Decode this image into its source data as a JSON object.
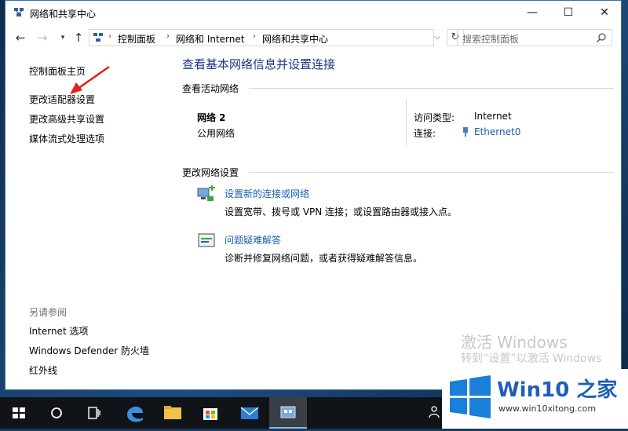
{
  "window": {
    "title": "网络和共享中心",
    "min_glyph": "—",
    "max_glyph": "☐",
    "close_glyph": "✕"
  },
  "nav": {
    "breadcrumb": [
      "控制面板",
      "网络和 Internet",
      "网络和共享中心"
    ],
    "search_placeholder": "搜索控制面板"
  },
  "sidebar": {
    "items": [
      "控制面板主页",
      "更改适配器设置",
      "更改高级共享设置",
      "媒体流式处理选项"
    ],
    "see_also_label": "另请参阅",
    "see_also": [
      "Internet 选项",
      "Windows Defender 防火墙",
      "红外线"
    ]
  },
  "main": {
    "title": "查看基本网络信息并设置连接",
    "active_networks_label": "查看活动网络",
    "network": {
      "name": "网络 2",
      "type": "公用网络",
      "access_type_label": "访问类型:",
      "access_type_value": "Internet",
      "connection_label": "连接:",
      "connection_value": "Ethernet0"
    },
    "change_settings_label": "更改网络设置",
    "tasks": [
      {
        "link": "设置新的连接或网络",
        "desc": "设置宽带、拨号或 VPN 连接；或设置路由器或接入点。"
      },
      {
        "link": "问题疑难解答",
        "desc": "诊断并修复网络问题，或者获得疑难解答信息。"
      }
    ]
  },
  "watermark": {
    "line1": "激活 Windows",
    "line2": "转到“设置”以激活 Windows"
  },
  "logo": {
    "text": "Win10 之家",
    "url": "www.win10xitong.com"
  },
  "colors": {
    "link": "#1a5fb4",
    "title": "#1e3287",
    "taskbar": "#101418",
    "annotation": "#e0201c"
  }
}
